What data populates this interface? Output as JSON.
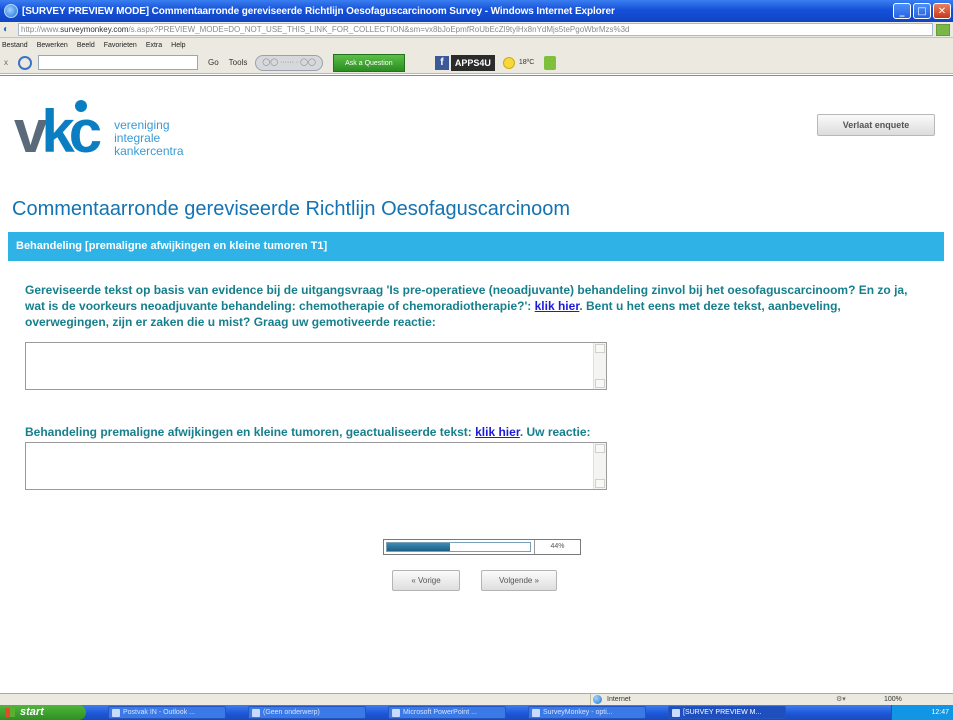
{
  "window": {
    "title": "[SURVEY PREVIEW MODE] Commentaarronde gereviseerde Richtlijn Oesofaguscarcinoom Survey - Windows Internet Explorer",
    "minimize": "_",
    "maximize": "□",
    "close": "✕"
  },
  "address": {
    "url_prefix": "http://www.",
    "url_domain": "surveymonkey.com",
    "url_rest": "/s.aspx?PREVIEW_MODE=DO_NOT_USE_THIS_LINK_FOR_COLLECTION&sm=vx8bJoEpmfRoUbEcZl9tylHx8nYdMjs5tePgoWbrMzs%3d"
  },
  "menu": [
    "Bestand",
    "Bewerken",
    "Beeld",
    "Favorieten",
    "Extra",
    "Help"
  ],
  "toolbar": {
    "close": "x",
    "go": "Go",
    "tools": "Tools",
    "ask": "Ask a Question",
    "apps": "APPS4U",
    "temp": "18ºC"
  },
  "page": {
    "logo": {
      "letters_v": "v",
      "letters_kc": "kc",
      "line1": "vereniging",
      "line2": "integrale",
      "line3": "kankercentra"
    },
    "exit_button": "Verlaat enquete",
    "survey_title": "Commentaarronde gereviseerde Richtlijn Oesofaguscarcinoom",
    "section_title": "Behandeling [premaligne afwijkingen en kleine tumoren T1]",
    "q1": {
      "text": "Gereviseerde tekst op basis van evidence bij de uitgangsvraag 'Is pre-operatieve (neoadjuvante) behandeling zinvol bij het oesofaguscarcinoom? En zo ja, wat is de voorkeurs neoadjuvante behandeling: chemotherapie of chemoradiotherapie?': ",
      "link": "klik hier",
      "text_after": ". Bent u het eens met deze tekst, aanbeveling, overwegingen, zijn er zaken die u mist? Graag uw gemotiveerde reactie:"
    },
    "q2": {
      "text": "Behandeling premaligne afwijkingen en kleine tumoren, geactualiseerde tekst: ",
      "link": "klik hier",
      "text_after": ". Uw reactie:"
    },
    "progress": {
      "percent": 44,
      "label": "44%"
    },
    "prev_button": "« Vorige",
    "next_button": "Volgende »"
  },
  "statusbar": {
    "zone": "Internet",
    "zoom": "100%"
  },
  "taskbar": {
    "start": "start",
    "tasks": [
      "Postvak IN - Outlook ...",
      "(Geen onderwerp)",
      "Microsoft PowerPoint ...",
      "SurveyMonkey - opti...",
      "[SURVEY PREVIEW M..."
    ],
    "clock": "12:47"
  },
  "colors": {
    "section_bar": "#2fb2e6",
    "question_text": "#167f8c",
    "title_blue": "#1473b2",
    "link": "#1b1bdb"
  }
}
